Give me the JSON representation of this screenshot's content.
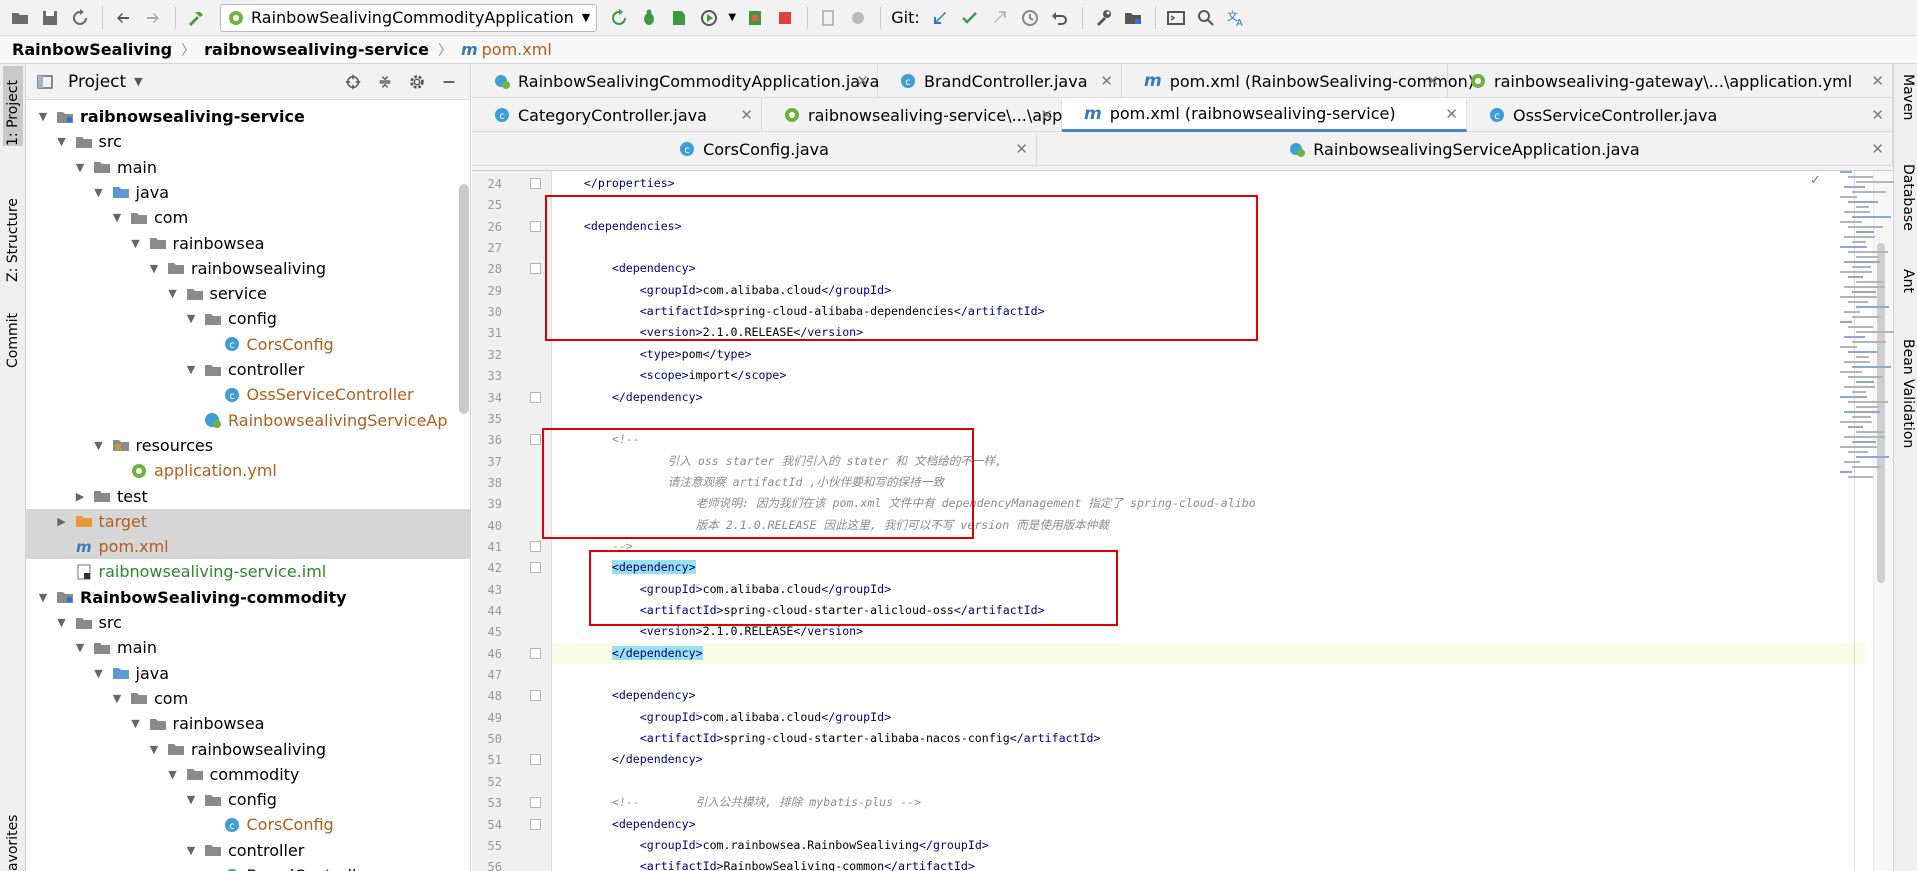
{
  "toolbar": {
    "run_config": "RainbowSealivingCommodityApplication",
    "git_label": "Git:"
  },
  "nav": {
    "crumb1": "RainbowSealiving",
    "crumb2": "raibnowsealiving-service",
    "file": "pom.xml"
  },
  "left_strip": {
    "project": "1: Project",
    "structure": "Z: Structure",
    "commit": "Commit",
    "favorites": "avorites"
  },
  "right_strip": {
    "maven": "Maven",
    "database": "Database",
    "ant": "Ant",
    "bean": "Bean Validation"
  },
  "project": {
    "title": "Project",
    "tree": [
      {
        "label": "raibnowsealiving-service",
        "style": "bold"
      },
      {
        "label": "src"
      },
      {
        "label": "main"
      },
      {
        "label": "java"
      },
      {
        "label": "com"
      },
      {
        "label": "rainbowsea"
      },
      {
        "label": "rainbowsealiving"
      },
      {
        "label": "service"
      },
      {
        "label": "config"
      },
      {
        "label": "CorsConfig",
        "style": "java"
      },
      {
        "label": "controller"
      },
      {
        "label": "OssServiceController",
        "style": "java"
      },
      {
        "label": "RainbowsealivingServiceAp",
        "style": "java"
      },
      {
        "label": "resources"
      },
      {
        "label": "application.yml",
        "style": "java"
      },
      {
        "label": "test"
      },
      {
        "label": "target",
        "style": "java"
      },
      {
        "label": "pom.xml",
        "style": "java"
      },
      {
        "label": "raibnowsealiving-service.iml",
        "style": "green"
      },
      {
        "label": "RainbowSealiving-commodity",
        "style": "bold"
      },
      {
        "label": "src"
      },
      {
        "label": "main"
      },
      {
        "label": "java"
      },
      {
        "label": "com"
      },
      {
        "label": "rainbowsea"
      },
      {
        "label": "rainbowsealiving"
      },
      {
        "label": "commodity"
      },
      {
        "label": "config"
      },
      {
        "label": "CorsConfig",
        "style": "java"
      },
      {
        "label": "controller"
      },
      {
        "label": "BrandController"
      }
    ]
  },
  "tabs": {
    "row1": [
      "RainbowSealivingCommodityApplication.java",
      "BrandController.java",
      "pom.xml (RainbowSealiving-common)",
      "rainbowsealiving-gateway\\...\\application.yml"
    ],
    "row2": [
      "CategoryController.java",
      "raibnowsealiving-service\\...\\application.yml",
      "pom.xml (raibnowsealiving-service)",
      "OssServiceController.java"
    ],
    "row3": [
      "CorsConfig.java",
      "RainbowsealivingServiceApplication.java"
    ]
  },
  "editor": {
    "line_numbers": [
      "24",
      "25",
      "26",
      "27",
      "28",
      "29",
      "30",
      "31",
      "32",
      "33",
      "34",
      "35",
      "36",
      "37",
      "38",
      "39",
      "40",
      "41",
      "42",
      "43",
      "44",
      "45",
      "46",
      "47",
      "48",
      "49",
      "50",
      "51",
      "52",
      "53",
      "54",
      "55",
      "56"
    ],
    "lines": [
      "    </properties>",
      "",
      "    <dependencies>",
      "",
      "        <dependency>",
      "            <groupId>com.alibaba.cloud</groupId>",
      "            <artifactId>spring-cloud-alibaba-dependencies</artifactId>",
      "            <version>2.1.0.RELEASE</version>",
      "            <type>pom</type>",
      "            <scope>import</scope>",
      "        </dependency>",
      "",
      "        <!--",
      "                引入 oss starter 我们引入的 stater 和 文档给的不一样,",
      "                请注意观察 artifactId ,小伙伴要和写的保持一致",
      "                    老师说明: 因为我们在该 pom.xml 文件中有 dependencyManagement 指定了 spring-cloud-alibo",
      "                    版本 2.1.0.RELEASE 因此这里, 我们可以不写 version 而是使用版本仲裁",
      "        -->",
      "        <dependency>",
      "            <groupId>com.alibaba.cloud</groupId>",
      "            <artifactId>spring-cloud-starter-alicloud-oss</artifactId>",
      "            <version>2.1.0.RELEASE</version>",
      "        </dependency>",
      "",
      "        <dependency>",
      "            <groupId>com.alibaba.cloud</groupId>",
      "            <artifactId>spring-cloud-starter-alibaba-nacos-config</artifactId>",
      "        </dependency>",
      "",
      "        <!--        引入公共模块, 排除 mybatis-plus -->",
      "        <dependency>",
      "            <groupId>com.rainbowsea.RainbowSealiving</groupId>",
      "            <artifactId>RainbowSealiving-common</artifactId>"
    ]
  },
  "colors": {
    "accent": "#4a86c7",
    "tag": "#000080",
    "highlight_box": "#e00000",
    "file_orange": "#b25f1a",
    "iml_green": "#2a8a2a"
  }
}
